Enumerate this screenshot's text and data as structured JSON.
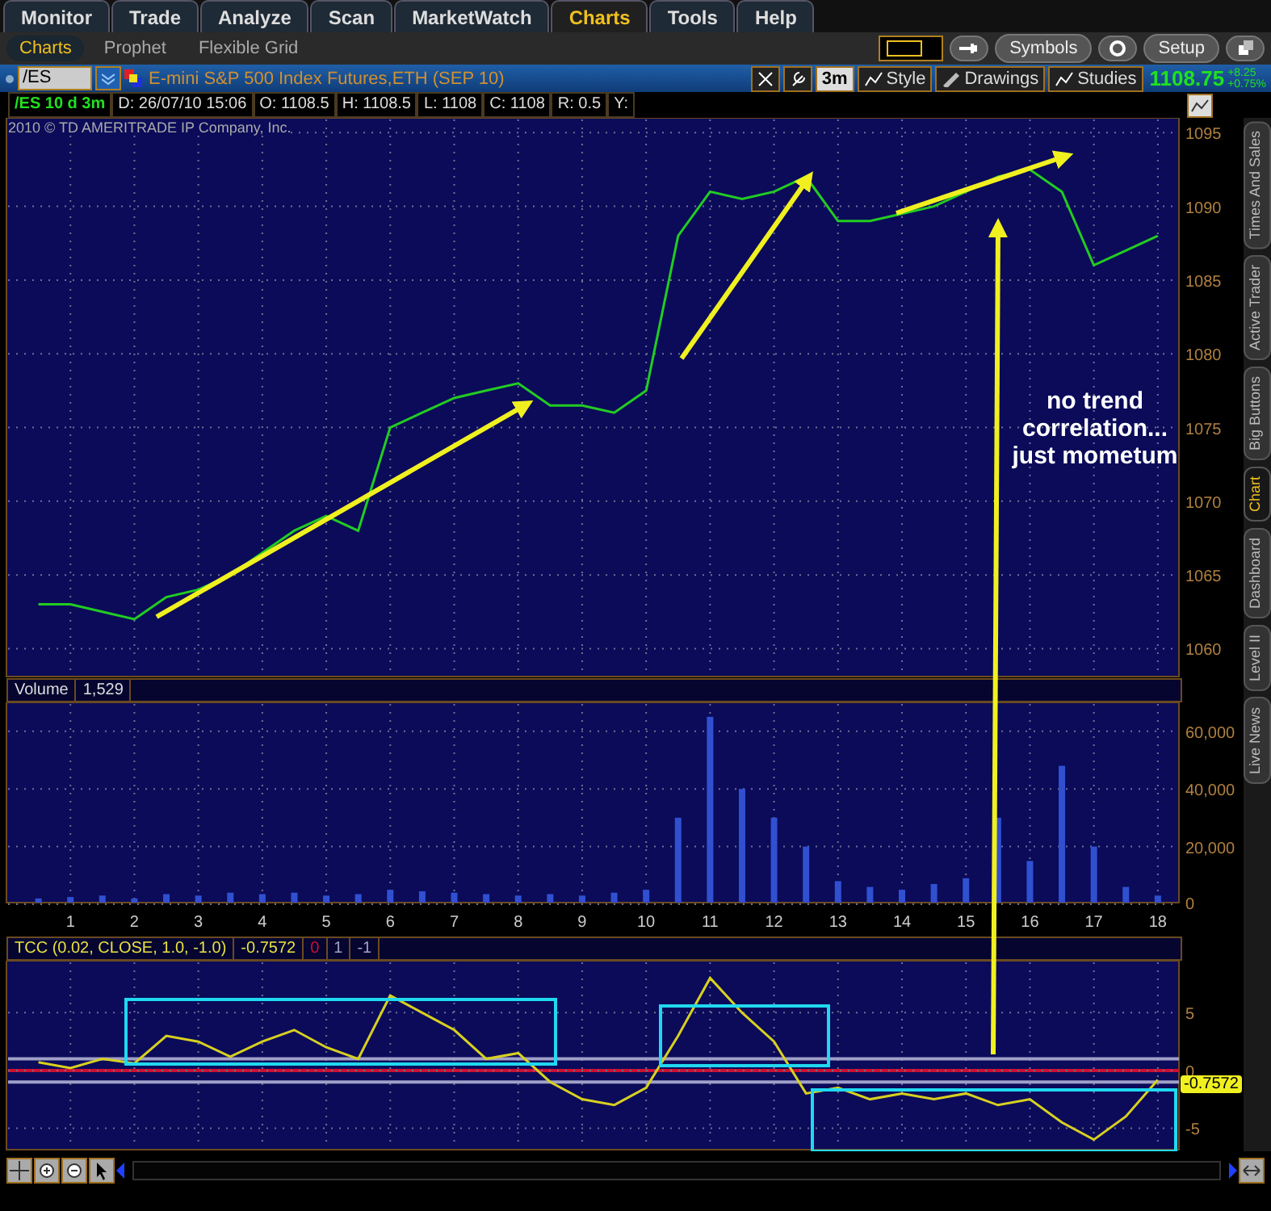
{
  "main_tabs": [
    {
      "label": "Monitor",
      "selected": false
    },
    {
      "label": "Trade",
      "selected": false
    },
    {
      "label": "Analyze",
      "selected": false
    },
    {
      "label": "Scan",
      "selected": false
    },
    {
      "label": "MarketWatch",
      "selected": false
    },
    {
      "label": "Charts",
      "selected": true
    },
    {
      "label": "Tools",
      "selected": false
    },
    {
      "label": "Help",
      "selected": false
    }
  ],
  "sub_tabs": [
    {
      "label": "Charts",
      "selected": true
    },
    {
      "label": "Prophet",
      "selected": false
    },
    {
      "label": "Flexible Grid",
      "selected": false
    }
  ],
  "top_buttons": [
    {
      "label": "Symbols"
    },
    {
      "label": "Setup"
    }
  ],
  "symbol_bar": {
    "symbol": "/ES",
    "description": "E-mini S&P 500 Index Futures,ETH (SEP 10)",
    "interval": "3m",
    "buttons": [
      "Style",
      "Drawings",
      "Studies"
    ],
    "last_price": "1108.75",
    "change": "+8.25",
    "change_percent": "+0.75%"
  },
  "info_bar": {
    "title": "/ES 10 d 3m",
    "fields": [
      "D: 26/07/10 15:06",
      "O: 1108.5",
      "H: 1108.5",
      "L: 1108",
      "C: 1108",
      "R: 0.5",
      "Y:"
    ]
  },
  "copyright": "2010 © TD AMERITRADE IP Company, Inc.",
  "price_panel": {
    "chart_data": {
      "type": "line",
      "x": [
        0.5,
        1,
        1.5,
        2,
        2.5,
        3,
        3.5,
        4,
        4.5,
        5,
        5.5,
        6,
        6.5,
        7,
        7.5,
        8,
        8.5,
        9,
        9.5,
        10,
        10.5,
        11,
        11.5,
        12,
        12.5,
        13,
        13.5,
        14,
        14.5,
        15,
        15.5,
        16,
        16.5,
        17,
        17.5,
        18
      ],
      "grid": true,
      "series": [
        {
          "color": "#22cc22",
          "values": [
            1063,
            1063,
            1062.5,
            1062,
            1063.5,
            1064,
            1065,
            1066.5,
            1068,
            1069,
            1068,
            1075,
            1076,
            1077,
            1077.5,
            1078,
            1076.5,
            1076.5,
            1076,
            1077.5,
            1088,
            1091,
            1090.5,
            1091,
            1092,
            1089,
            1089,
            1089.5,
            1090,
            1091,
            1092,
            1092.5,
            1091,
            1086,
            1087,
            1088
          ]
        }
      ],
      "xlim": [
        0,
        18.33
      ],
      "ylim": [
        1058,
        1096
      ],
      "yticks": [
        1060,
        1065,
        1070,
        1075,
        1080,
        1085,
        1090,
        1095
      ],
      "annotations": [
        {
          "text": "no trend correlation... just mometum"
        }
      ]
    }
  },
  "volume_panel": {
    "label": "Volume",
    "value": "1,529",
    "chart_data": {
      "type": "bar",
      "x": [
        0.5,
        1,
        1.5,
        2,
        2.5,
        3,
        3.5,
        4,
        4.5,
        5,
        5.5,
        6,
        6.5,
        7,
        7.5,
        8,
        8.5,
        9,
        9.5,
        10,
        10.5,
        11,
        11.5,
        12,
        12.5,
        13,
        13.5,
        14,
        14.5,
        15,
        15.5,
        16,
        16.5,
        17,
        17.5,
        18
      ],
      "grid": true,
      "series": [
        {
          "color": "#3050d0",
          "values": [
            2000,
            2500,
            3000,
            2000,
            3500,
            3000,
            4000,
            3500,
            4000,
            3000,
            3500,
            5000,
            4500,
            4000,
            3500,
            3000,
            3500,
            3000,
            4000,
            5000,
            30000,
            65000,
            40000,
            30000,
            20000,
            8000,
            6000,
            5000,
            7000,
            9000,
            30000,
            15000,
            48000,
            20000,
            6000,
            3000
          ]
        }
      ],
      "xlim": [
        0,
        18.33
      ],
      "ylim": [
        0,
        70000
      ],
      "xticks": [
        1,
        2,
        3,
        4,
        5,
        6,
        7,
        8,
        9,
        10,
        11,
        12,
        13,
        14,
        15,
        16,
        17,
        18
      ],
      "yticks": [
        0,
        {
          "value": 20000,
          "label": "20,000"
        },
        {
          "value": 40000,
          "label": "40,000"
        },
        {
          "value": 60000,
          "label": "60,000"
        }
      ]
    }
  },
  "tcc_panel": {
    "label": "TCC (0.02, CLOSE, 1.0, -1.0)",
    "value": "-0.7572",
    "badge_value": "-0.7572",
    "chart_data": {
      "type": "line",
      "x": [
        0.5,
        1,
        1.5,
        2,
        2.5,
        3,
        3.5,
        4,
        4.5,
        5,
        5.5,
        6,
        6.5,
        7,
        7.5,
        8,
        8.5,
        9,
        9.5,
        10,
        10.5,
        11,
        11.5,
        12,
        12.5,
        13,
        13.5,
        14,
        14.5,
        15,
        15.5,
        16,
        16.5,
        17,
        17.5,
        18
      ],
      "grid": true,
      "ref_lines": [
        {
          "axis": "y",
          "value": 0,
          "label": "0",
          "color": "#cc1030"
        },
        {
          "axis": "y",
          "value": 1,
          "label": "1",
          "color": "#a0a0c8"
        },
        {
          "axis": "y",
          "value": -1,
          "label": "-1",
          "color": "#a0a0c8"
        }
      ],
      "series": [
        {
          "color": "#d8d020",
          "values": [
            0.7,
            0.2,
            1,
            0.6,
            3,
            2.5,
            1.2,
            2.5,
            3.5,
            2,
            1,
            6.5,
            5,
            3.5,
            1,
            1.5,
            -1,
            -2.5,
            -3,
            -1.5,
            3,
            8,
            5,
            2.5,
            -2,
            -1.5,
            -2.5,
            -2,
            -2.5,
            -2,
            -3,
            -2.5,
            -4.5,
            -6,
            -4,
            -0.8
          ]
        }
      ],
      "xlim": [
        0,
        18.33
      ],
      "ylim": [
        -7,
        9.5
      ],
      "yticks": [
        -5,
        0,
        5
      ]
    }
  },
  "side_tabs": [
    {
      "label": "Times And Sales",
      "selected": false
    },
    {
      "label": "Active Trader",
      "selected": false
    },
    {
      "label": "Big Buttons",
      "selected": false
    },
    {
      "label": "Chart",
      "selected": true
    },
    {
      "label": "Dashboard",
      "selected": false
    },
    {
      "label": "Level II",
      "selected": false
    },
    {
      "label": "Live News",
      "selected": false
    }
  ]
}
